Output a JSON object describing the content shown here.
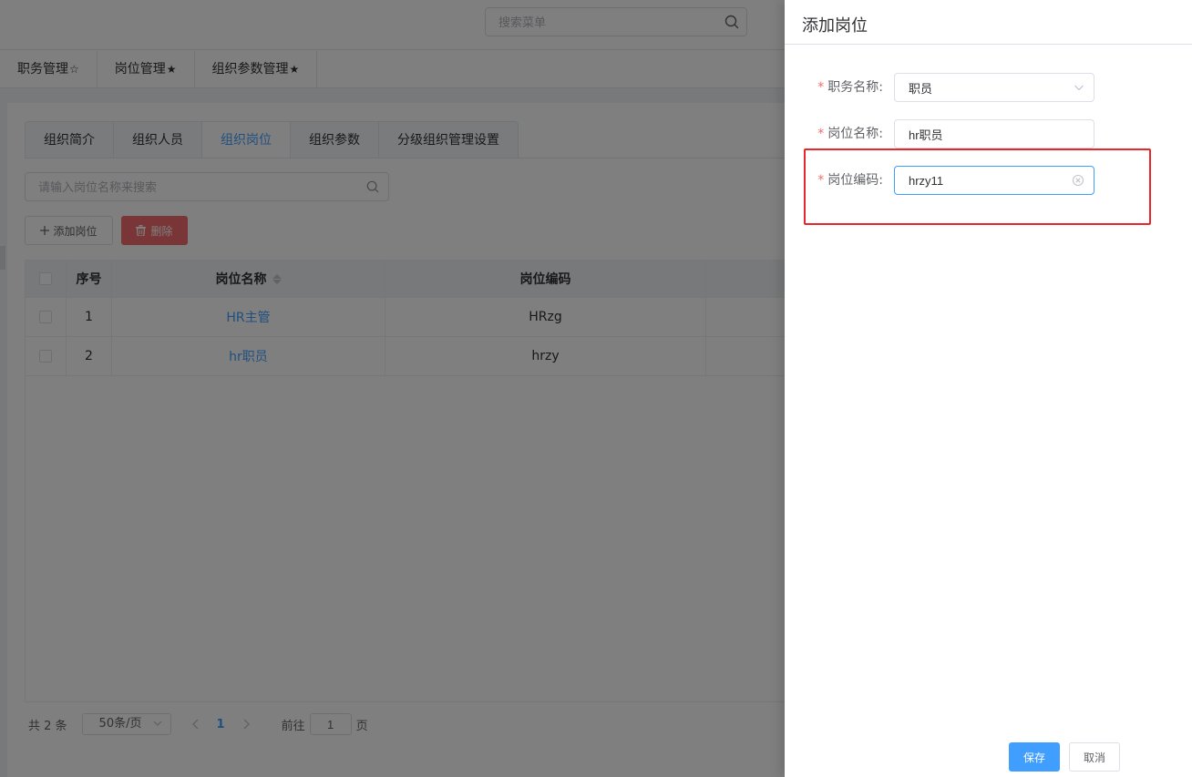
{
  "header": {
    "menu_search_placeholder": "搜索菜单",
    "search_icon": "search-icon"
  },
  "page_tabs": [
    {
      "label": "职务管理",
      "mark": "☆"
    },
    {
      "label": "岗位管理",
      "mark": "★"
    },
    {
      "label": "组织参数管理",
      "mark": "★"
    }
  ],
  "sub_tabs": [
    {
      "label": "组织简介"
    },
    {
      "label": "组织人员"
    },
    {
      "label": "组织岗位"
    },
    {
      "label": "组织参数"
    },
    {
      "label": "分级组织管理设置"
    }
  ],
  "sub_tabs_active": "组织岗位",
  "position_search": {
    "placeholder": "请输入岗位名称来搜索"
  },
  "toolbar": {
    "add_label": "添加岗位",
    "add_icon": "plus-icon",
    "delete_label": "删除",
    "delete_icon": "trash-icon"
  },
  "table": {
    "columns": [
      "序号",
      "岗位名称",
      "岗位编码"
    ],
    "rows": [
      {
        "index": "1",
        "name": "HR主管",
        "code": "HRzg"
      },
      {
        "index": "2",
        "name": "hr职员",
        "code": "hrzy"
      }
    ]
  },
  "pagination": {
    "total_text": "共 2 条",
    "page_size": "50条/页",
    "current_page": "1",
    "goto_prefix": "前往",
    "goto_value": "1",
    "goto_suffix": "页"
  },
  "drawer": {
    "title": "添加岗位",
    "fields": {
      "duty_name": {
        "label": "职务名称:",
        "value": "职员"
      },
      "position_name": {
        "label": "岗位名称:",
        "value": "hr职员"
      },
      "position_code": {
        "label": "岗位编码:",
        "value": "hrzy11"
      }
    },
    "required_mark": "*",
    "save_label": "保存",
    "cancel_label": "取消"
  },
  "colors": {
    "primary": "#409eff",
    "danger": "#f56c6c",
    "highlight_box": "#e8272c"
  }
}
